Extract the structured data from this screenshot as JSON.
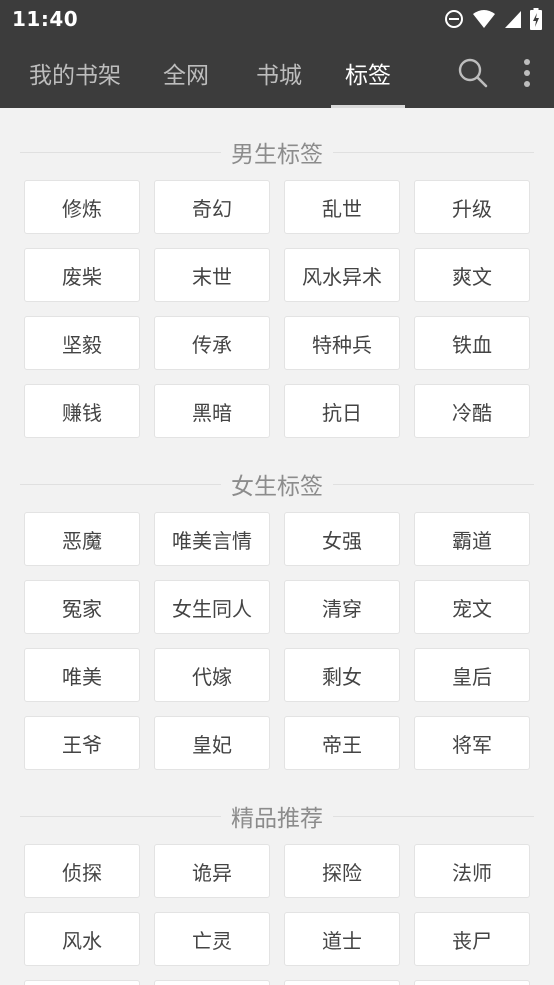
{
  "status": {
    "time": "11:40"
  },
  "tabs": [
    "我的书架",
    "全网",
    "书城",
    "标签"
  ],
  "active_tab": 3,
  "sections": [
    {
      "title": "男生标签",
      "tags": [
        "修炼",
        "奇幻",
        "乱世",
        "升级",
        "废柴",
        "末世",
        "风水异术",
        "爽文",
        "坚毅",
        "传承",
        "特种兵",
        "铁血",
        "赚钱",
        "黑暗",
        "抗日",
        "冷酷"
      ]
    },
    {
      "title": "女生标签",
      "tags": [
        "恶魔",
        "唯美言情",
        "女强",
        "霸道",
        "冤家",
        "女生同人",
        "清穿",
        "宠文",
        "唯美",
        "代嫁",
        "剩女",
        "皇后",
        "王爷",
        "皇妃",
        "帝王",
        "将军"
      ]
    },
    {
      "title": "精品推荐",
      "tags": [
        "侦探",
        "诡异",
        "探险",
        "法师",
        "风水",
        "亡灵",
        "道士",
        "丧尸",
        "",
        "",
        "",
        ""
      ]
    }
  ],
  "icons": {
    "search": "search-icon",
    "more": "more-vert-icon"
  },
  "colors": {
    "toolbar": "#3c3c3c",
    "background": "#f2f2f2"
  }
}
